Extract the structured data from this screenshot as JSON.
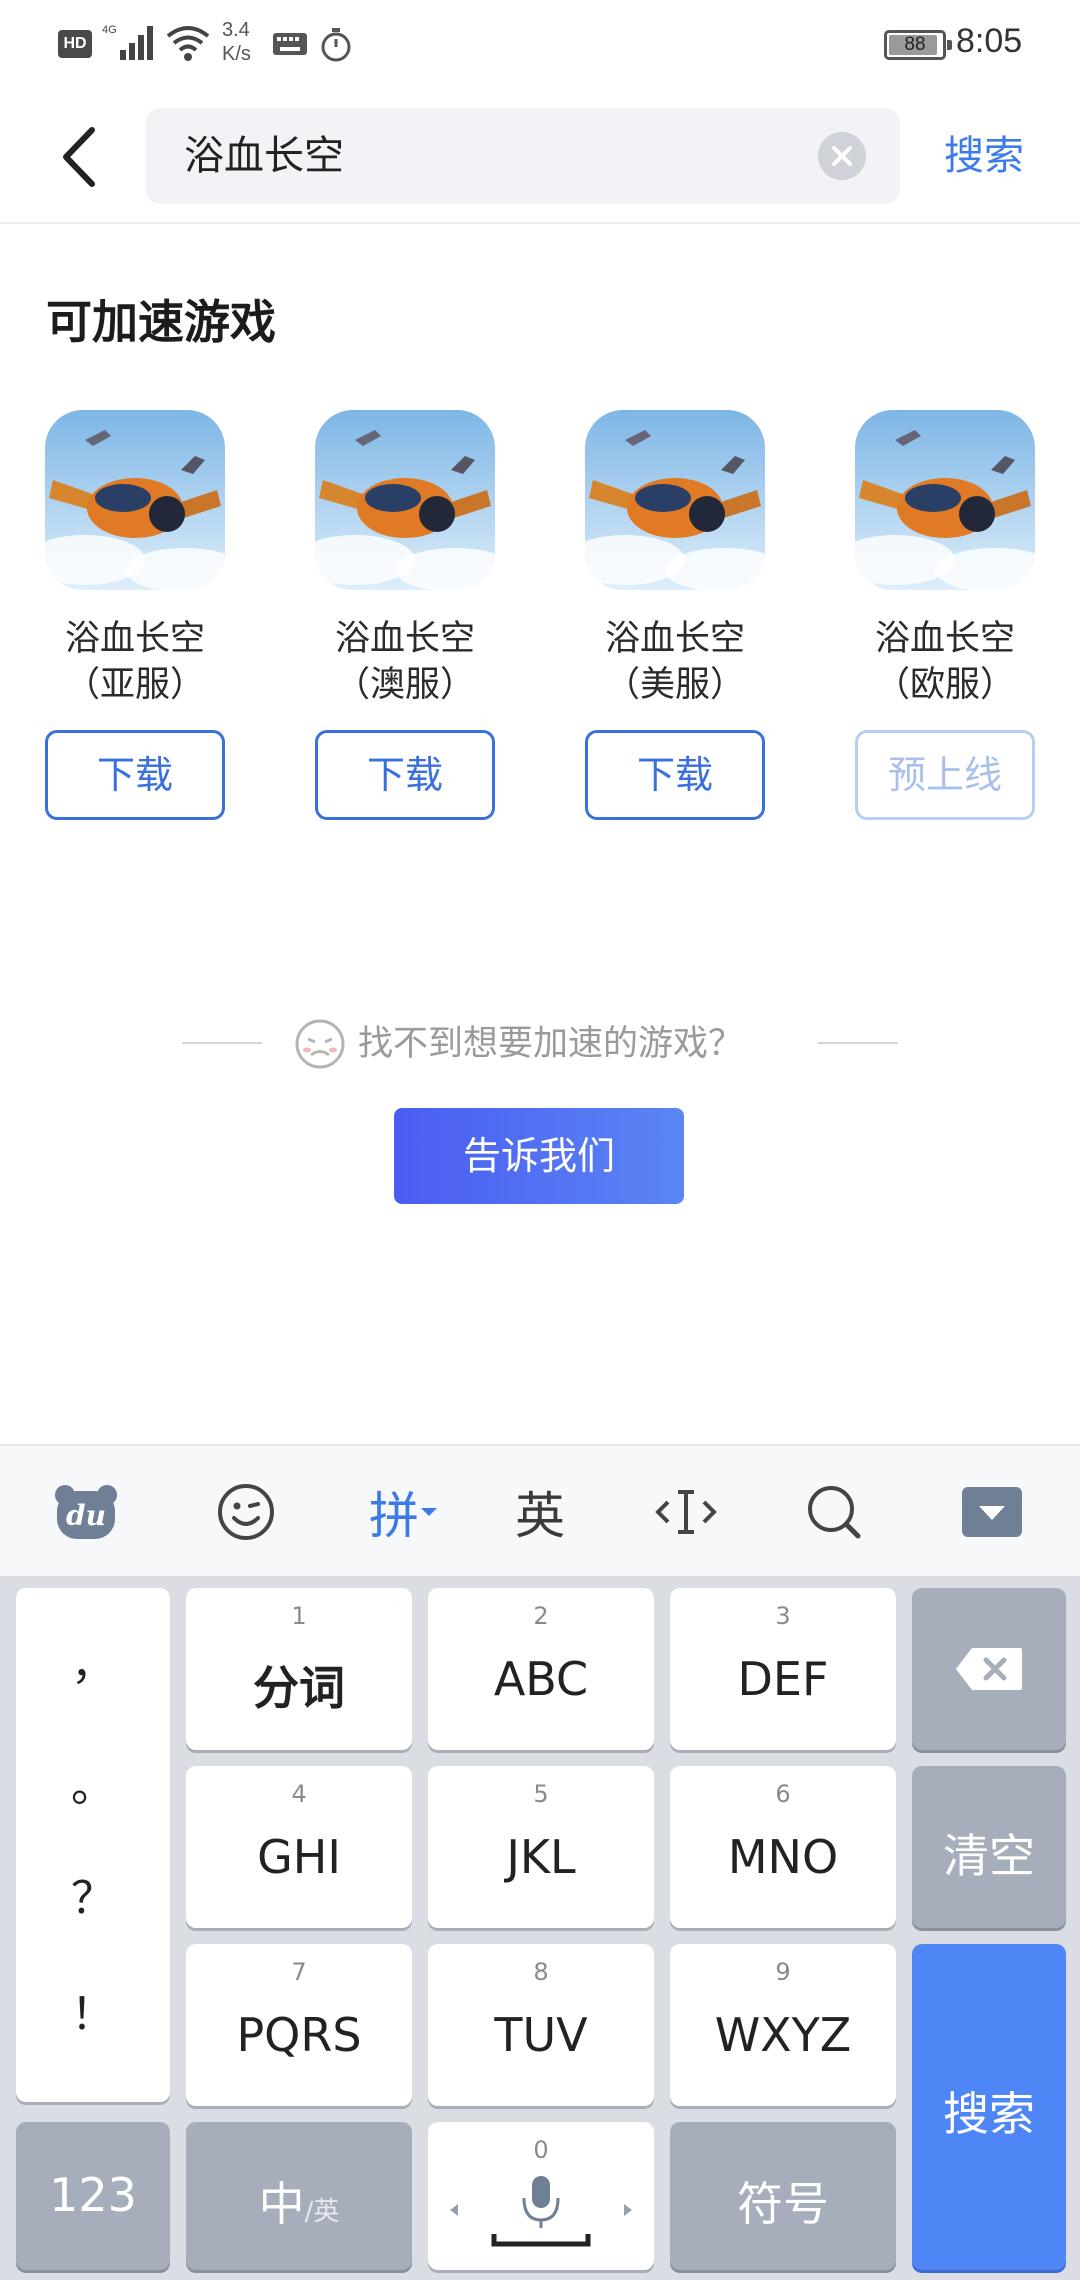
{
  "status_bar": {
    "hd": "HD",
    "network": "4G",
    "speed_value": "3.4",
    "speed_unit": "K/s",
    "battery": "88",
    "time": "8:05"
  },
  "header": {
    "query": "浴血长空",
    "search_label": "搜索"
  },
  "section_title": "可加速游戏",
  "games": [
    {
      "name": "浴血长空",
      "server": "（亚服）",
      "button": "下载",
      "enabled": true
    },
    {
      "name": "浴血长空",
      "server": "（澳服）",
      "button": "下载",
      "enabled": true
    },
    {
      "name": "浴血长空",
      "server": "（美服）",
      "button": "下载",
      "enabled": true
    },
    {
      "name": "浴血长空",
      "server": "（欧服）",
      "button": "预上线",
      "enabled": false
    }
  ],
  "feedback": {
    "text": "找不到想要加速的游戏？",
    "button": "告诉我们"
  },
  "keyboard": {
    "toolbar": {
      "pinyin": "拼",
      "english": "英"
    },
    "punctuation": [
      "，",
      "。",
      "？",
      "！"
    ],
    "keys": [
      {
        "num": "1",
        "label": "分词"
      },
      {
        "num": "2",
        "label": "ABC"
      },
      {
        "num": "3",
        "label": "DEF"
      },
      {
        "num": "4",
        "label": "GHI"
      },
      {
        "num": "5",
        "label": "JKL"
      },
      {
        "num": "6",
        "label": "MNO"
      },
      {
        "num": "7",
        "label": "PQRS"
      },
      {
        "num": "8",
        "label": "TUV"
      },
      {
        "num": "9",
        "label": "WXYZ"
      }
    ],
    "clear": "清空",
    "search": "搜索",
    "num_mode": "123",
    "lang_main": "中",
    "lang_sub": "/英",
    "zero": "0",
    "symbols": "符号"
  },
  "colors": {
    "accent": "#3c7be8",
    "button_gradient_start": "#4a5cf2",
    "button_gradient_end": "#5a86f4",
    "key_blue": "#4f86f6"
  }
}
